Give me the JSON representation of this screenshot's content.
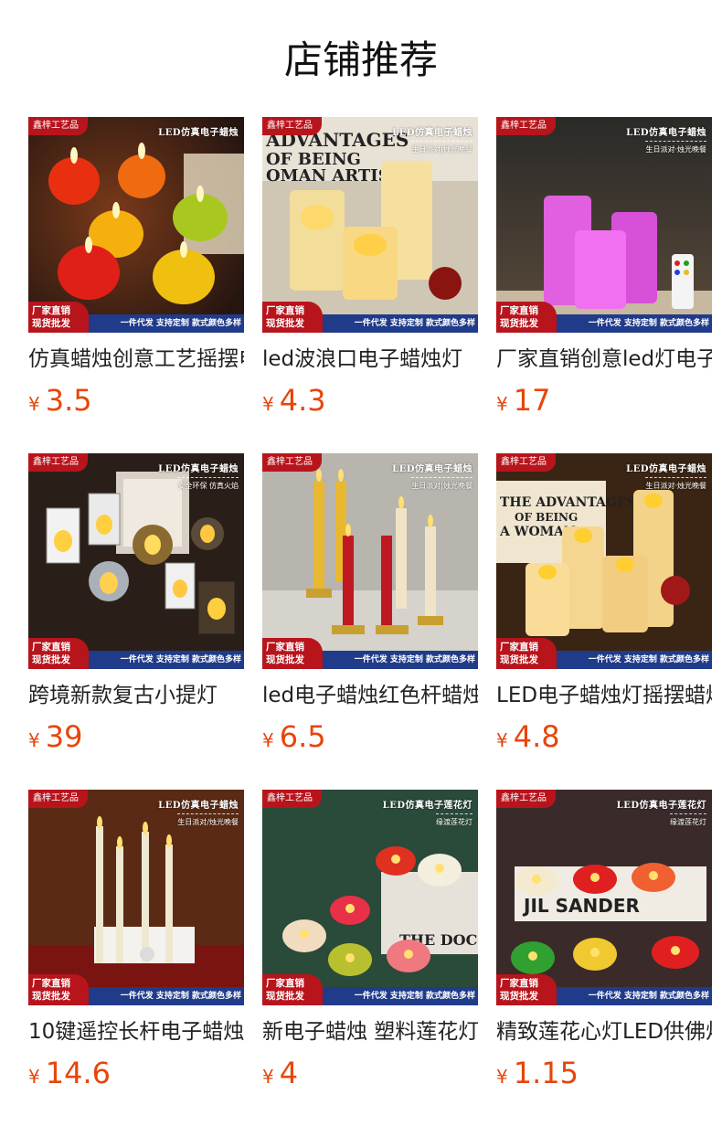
{
  "header": {
    "title": "店铺推荐"
  },
  "badges": {
    "shop": "鑫梓工艺品",
    "footer_left_line1": "厂家直销",
    "footer_left_line2": "现货批发",
    "footer_right": "一件代发 支持定制 款式颜色多样"
  },
  "colors": {
    "price": "#e8450a",
    "badge_red": "#b8141c",
    "badge_blue": "#1f3b8a"
  },
  "products": [
    {
      "name": "仿真蜡烛创意工艺摇摆电子蜡烛",
      "currency": "¥",
      "price": "3.5",
      "banner": "LED仿真电子蜡烛",
      "banner_sub": ""
    },
    {
      "name": "led波浪口电子蜡烛灯",
      "currency": "¥",
      "price": "4.3",
      "banner": "LED仿真电子蜡烛",
      "banner_sub": "生日派对|烛光晚餐"
    },
    {
      "name": "厂家直销创意led灯电子蜡烛",
      "currency": "¥",
      "price": "17",
      "banner": "LED仿真电子蜡烛",
      "banner_sub": "生日派对·烛光晚餐"
    },
    {
      "name": "跨境新款复古小提灯",
      "currency": "¥",
      "price": "39",
      "banner": "LED仿真电子蜡烛",
      "banner_sub": "安全环保  仿真火焰"
    },
    {
      "name": "led电子蜡烛红色杆蜡烛",
      "currency": "¥",
      "price": "6.5",
      "banner": "LED仿真电子蜡烛",
      "banner_sub": "生日派对|烛光晚餐"
    },
    {
      "name": "LED电子蜡烛灯摇摆蜡烛",
      "currency": "¥",
      "price": "4.8",
      "banner": "LED仿真电子蜡烛",
      "banner_sub": "生日派对·烛光晚餐"
    },
    {
      "name": "10键遥控长杆电子蜡烛",
      "currency": "¥",
      "price": "14.6",
      "banner": "LED仿真电子蜡烛",
      "banner_sub": "生日派对/烛光晚餐"
    },
    {
      "name": "新电子蜡烛 塑料莲花灯",
      "currency": "¥",
      "price": "4",
      "banner": "LED仿真电子莲花灯",
      "banner_sub": "缘渡莲花灯"
    },
    {
      "name": "精致莲花心灯LED供佛灯",
      "currency": "¥",
      "price": "1.15",
      "banner": "LED仿真电子莲花灯",
      "banner_sub": "缘渡莲花灯"
    }
  ]
}
